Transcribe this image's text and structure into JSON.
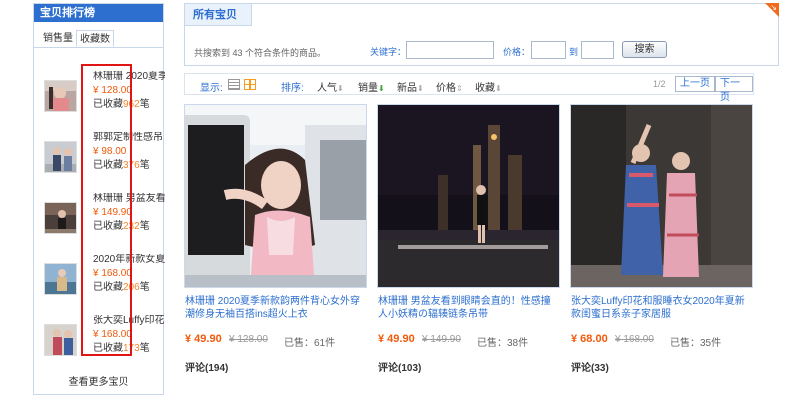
{
  "sidebar": {
    "title": "宝贝排行榜",
    "tabs": [
      "销售量",
      "收藏数"
    ],
    "items": [
      {
        "name": "林珊珊 2020夏季",
        "price": "¥ 128.00",
        "fav_prefix": "已收藏",
        "fav_count": "962",
        "fav_suffix": "笔"
      },
      {
        "name": "郭郭定制性感吊",
        "price": "¥ 98.00",
        "fav_prefix": "已收藏",
        "fav_count": "376",
        "fav_suffix": "笔"
      },
      {
        "name": "林珊珊 男盆友看",
        "price": "¥ 149.90",
        "fav_prefix": "已收藏",
        "fav_count": "232",
        "fav_suffix": "笔"
      },
      {
        "name": "2020年新款女夏",
        "price": "¥ 168.00",
        "fav_prefix": "已收藏",
        "fav_count": "206",
        "fav_suffix": "笔"
      },
      {
        "name": "张大奕Luffy印花",
        "price": "¥ 168.00",
        "fav_prefix": "已收藏",
        "fav_count": "173",
        "fav_suffix": "笔"
      }
    ],
    "more": "查看更多宝贝"
  },
  "header": {
    "title": "所有宝贝",
    "result_count": "共搜索到 43 个符合条件的商品。",
    "keyword_label": "关键字：",
    "price_label": "价格：",
    "price_to": "到",
    "search_button": "搜索"
  },
  "sortbar": {
    "display_label": "显示:",
    "sort_label": "排序:",
    "options": [
      "人气",
      "销量",
      "新品",
      "价格",
      "收藏"
    ],
    "page_indicator": "1/2",
    "prev": "上一页",
    "next": "下一页"
  },
  "products": [
    {
      "title": "林珊珊 2020夏季新款韵两件背心女外穿潮修身无袖百搭ins超火上衣",
      "price": "¥ 49.90",
      "original": "¥ 128.00",
      "sold": "已售：61件",
      "reviews": "评论(194)"
    },
    {
      "title": "林珊珊 男盆友看到眼睛会直的！性感撞人小妖精の辐辏链条吊带",
      "price": "¥ 49.90",
      "original": "¥ 149.90",
      "sold": "已售：38件",
      "reviews": "评论(103)"
    },
    {
      "title": "张大奕Luffy印花和服睡衣女2020年夏新款闺蜜日系亲子家居服",
      "price": "¥ 68.00",
      "original": "¥ 168.00",
      "sold": "已售：35件",
      "reviews": "评论(33)"
    }
  ],
  "colors": {
    "accent": "#2c6fcf",
    "price": "#f05a0a",
    "highlight_box": "#e21515"
  }
}
